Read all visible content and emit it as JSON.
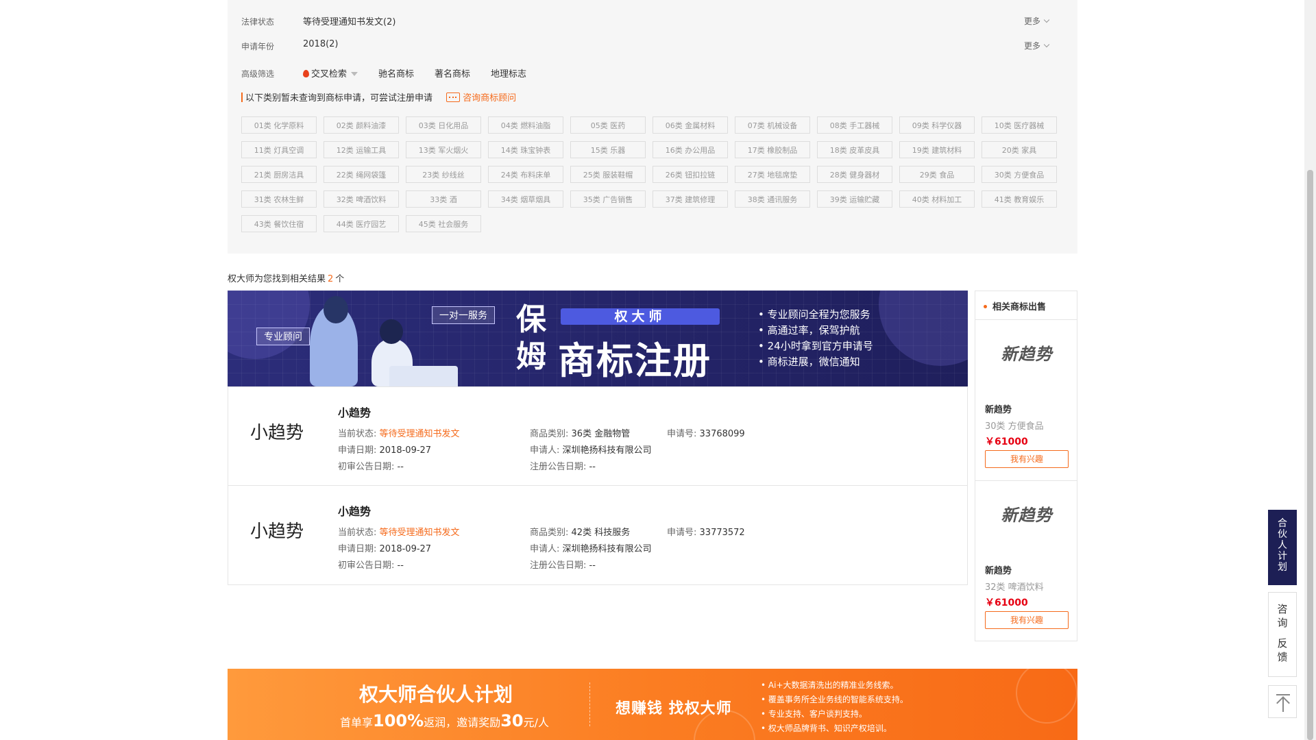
{
  "filters": {
    "legal_status_label": "法律状态",
    "legal_status_value": "等待受理通知书发文(2)",
    "year_label": "申请年份",
    "year_value": "2018(2)",
    "more_label": "更多",
    "advanced_label": "高级筛选",
    "advanced_items": [
      "交叉检索",
      "驰名商标",
      "著名商标",
      "地理标志"
    ]
  },
  "notice": {
    "text": "以下类别暂未查询到商标申请，可尝试注册申请",
    "consult": "咨询商标顾问"
  },
  "classes": [
    "01类 化学原料",
    "02类 颜料油漆",
    "03类 日化用品",
    "04类 燃料油脂",
    "05类 医药",
    "06类 金属材料",
    "07类 机械设备",
    "08类 手工器械",
    "09类 科学仪器",
    "10类 医疗器械",
    "11类 灯具空调",
    "12类 运输工具",
    "13类 军火烟火",
    "14类 珠宝钟表",
    "15类 乐器",
    "16类 办公用品",
    "17类 橡胶制品",
    "18类 皮革皮具",
    "19类 建筑材料",
    "20类 家具",
    "21类 厨房洁具",
    "22类 绳网袋篷",
    "23类 纱线丝",
    "24类 布料床单",
    "25类 服装鞋帽",
    "26类 钮扣拉链",
    "27类 地毯席垫",
    "28类 健身器材",
    "29类 食品",
    "30类 方便食品",
    "31类 农林生鲜",
    "32类 啤酒饮料",
    "33类 酒",
    "34类 烟草烟具",
    "35类 广告销售",
    "37类 建筑修理",
    "38类 通讯服务",
    "39类 运输贮藏",
    "40类 材料加工",
    "41类 教育娱乐",
    "43类 餐饮住宿",
    "44类 医疗园艺",
    "45类 社会服务"
  ],
  "result_count": {
    "prefix": "权大师为您找到相关结果",
    "count": "2",
    "suffix": "个"
  },
  "banner": {
    "tag1": "专业顾问",
    "tag2": "一对一服务",
    "bao": "保姆",
    "brand": "权大师",
    "headline": "商标注册",
    "points": [
      "专业顾问全程为您服务",
      "高通过率，保驾护航",
      "24小时拿到官方申请号",
      "商标进展，微信通知"
    ]
  },
  "labels": {
    "status": "当前状态:",
    "category": "商品类别:",
    "reg_no": "申请号:",
    "apply_date": "申请日期:",
    "applicant": "申请人:",
    "prelim_date": "初审公告日期:",
    "reg_date": "注册公告日期:"
  },
  "results": [
    {
      "logo": "小趋势",
      "name": "小趋势",
      "status": "等待受理通知书发文",
      "category": "36类 金融物管",
      "reg_no": "33768099",
      "apply_date": "2018-09-27",
      "applicant": "深圳艳扬科技有限公司",
      "prelim_date": "--",
      "reg_date": "--"
    },
    {
      "logo": "小趋势",
      "name": "小趋势",
      "status": "等待受理通知书发文",
      "category": "42类 科技服务",
      "reg_no": "33773572",
      "apply_date": "2018-09-27",
      "applicant": "深圳艳扬科技有限公司",
      "prelim_date": "--",
      "reg_date": "--"
    }
  ],
  "side": {
    "title": "相关商标出售",
    "items": [
      {
        "logo": "新趋势",
        "name": "新趋势",
        "class": "30类 方便食品",
        "price": "￥61000",
        "button": "我有兴趣"
      },
      {
        "logo": "新趋势",
        "name": "新趋势",
        "class": "32类 啤酒饮料",
        "price": "￥61000",
        "button": "我有兴趣"
      }
    ]
  },
  "partner": {
    "title": "权大师合伙人计划",
    "sub_prefix": "首单享",
    "sub_pct": "100%",
    "sub_mid": "返润，邀请奖励",
    "sub_amount": "30",
    "sub_suffix": "元/人",
    "slogan": "想赚钱 找权大师",
    "points": [
      "Ai+大数据清洗出的精准业务线索。",
      "覆盖事务所全业务线的智能系统支持。",
      "专业支持、客户谈判支持。",
      "权大师品牌背书、知识产权培训。"
    ]
  },
  "float": {
    "partner": "合伙人计划",
    "consult": "咨询",
    "feedback": "反馈"
  },
  "colors": {
    "accent": "#f56a1b",
    "price": "#e60012",
    "banner_bg": "#2c2d7a",
    "partner_bg": "#fb7d22",
    "float_dark": "#1d1f55"
  }
}
